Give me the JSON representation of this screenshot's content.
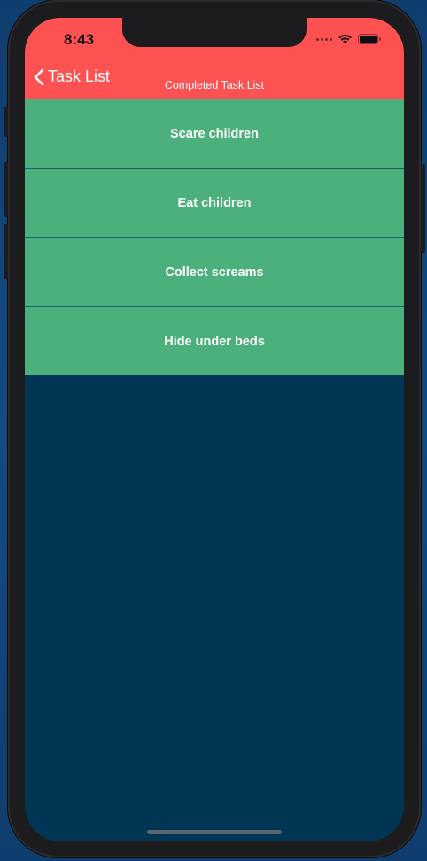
{
  "status_bar": {
    "time": "8:43"
  },
  "nav": {
    "back_label": "Task List",
    "title": "Completed Task List"
  },
  "tasks": [
    {
      "label": "Scare children"
    },
    {
      "label": "Eat children"
    },
    {
      "label": "Collect screams"
    },
    {
      "label": "Hide under beds"
    }
  ],
  "colors": {
    "header": "#fe5151",
    "task_bg": "#4cb07d",
    "screen_bg": "#003553"
  }
}
